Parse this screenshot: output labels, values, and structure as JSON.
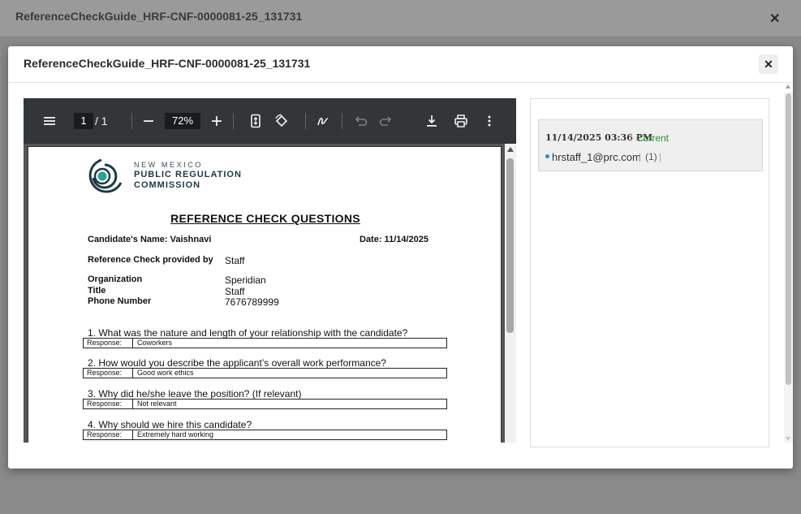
{
  "background_window": {
    "title": "ReferenceCheckGuide_HRF-CNF-0000081-25_131731",
    "close_glyph": "✕"
  },
  "modal": {
    "title": "ReferenceCheckGuide_HRF-CNF-0000081-25_131731",
    "close_glyph": "✕"
  },
  "toolbar": {
    "page_current": "1",
    "page_total": "/ 1",
    "zoom": "72%",
    "icons": [
      "menu-icon",
      "zoom-out-icon",
      "zoom-in-icon",
      "fit-page-icon",
      "rotate-icon",
      "annotate-icon",
      "undo-icon",
      "redo-icon",
      "download-icon",
      "print-icon",
      "more-options-icon"
    ]
  },
  "document": {
    "org": {
      "line1": "NEW MEXICO",
      "line2": "PUBLIC REGULATION",
      "line3": "COMMISSION"
    },
    "title": "REFERENCE CHECK QUESTIONS",
    "candidate": "Candidate's Name: Vaishnavi",
    "date": "Date: 11/14/2025",
    "fields": [
      {
        "label": "Reference Check provided by",
        "value": "Staff"
      },
      {
        "label": "Organization",
        "value": "Speridian"
      },
      {
        "label": "Title",
        "value": "Staff"
      },
      {
        "label": "Phone Number",
        "value": "7676789999"
      }
    ],
    "response_label": "Response:",
    "questions": [
      {
        "text": "1. What was the nature and length of your relationship with the candidate?",
        "response": "Coworkers"
      },
      {
        "text": "2. How would you describe the applicant’s overall work performance?",
        "response": "Good work ethics"
      },
      {
        "text": "3. Why did he/she leave the position? (If relevant)",
        "response": "Not relevant"
      },
      {
        "text": "4. Why should we hire this candidate?",
        "response": "Extremely hard working"
      }
    ]
  },
  "versions": {
    "date": "11/14/2025 03:36 PM",
    "separator": "|",
    "status": "Current",
    "user": "hrstaff_1@prc.com",
    "count": "(1)"
  },
  "colors": {
    "viewer_toolbar": "#323639",
    "viewer_bg": "#525659",
    "current_status": "#2e8b2e",
    "bullet": "#1f8fd6"
  }
}
